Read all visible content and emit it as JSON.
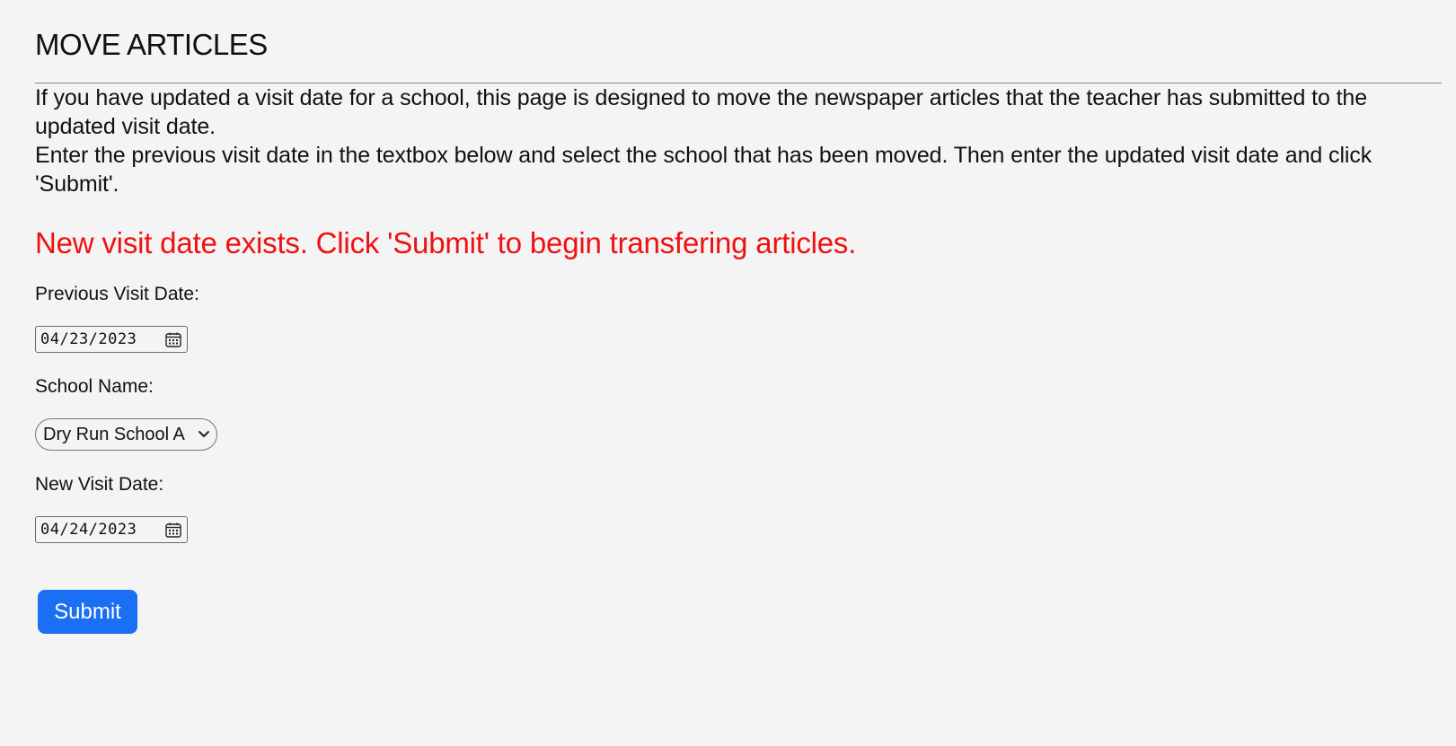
{
  "header": {
    "title": "MOVE ARTICLES"
  },
  "intro": {
    "paragraph1": "If you have updated a visit date for a school, this page is designed to move the newspaper articles that the teacher has submitted to the updated visit date.",
    "paragraph2": "Enter the previous visit date in the textbox below and select the school that has been moved. Then enter the updated visit date and click 'Submit'."
  },
  "status": {
    "message": "New visit date exists. Click 'Submit' to begin transfering articles.",
    "color": "#ee1111"
  },
  "form": {
    "previous_date": {
      "label": "Previous Visit Date:",
      "value": "04/23/2023",
      "icon": "calendar-icon"
    },
    "school": {
      "label": "School Name:",
      "selected": "Dry Run School A",
      "icon": "chevron-down-icon"
    },
    "new_date": {
      "label": "New Visit Date:",
      "value": "04/24/2023",
      "icon": "calendar-icon"
    },
    "submit_label": "Submit",
    "submit_color": "#1a6ff5"
  }
}
